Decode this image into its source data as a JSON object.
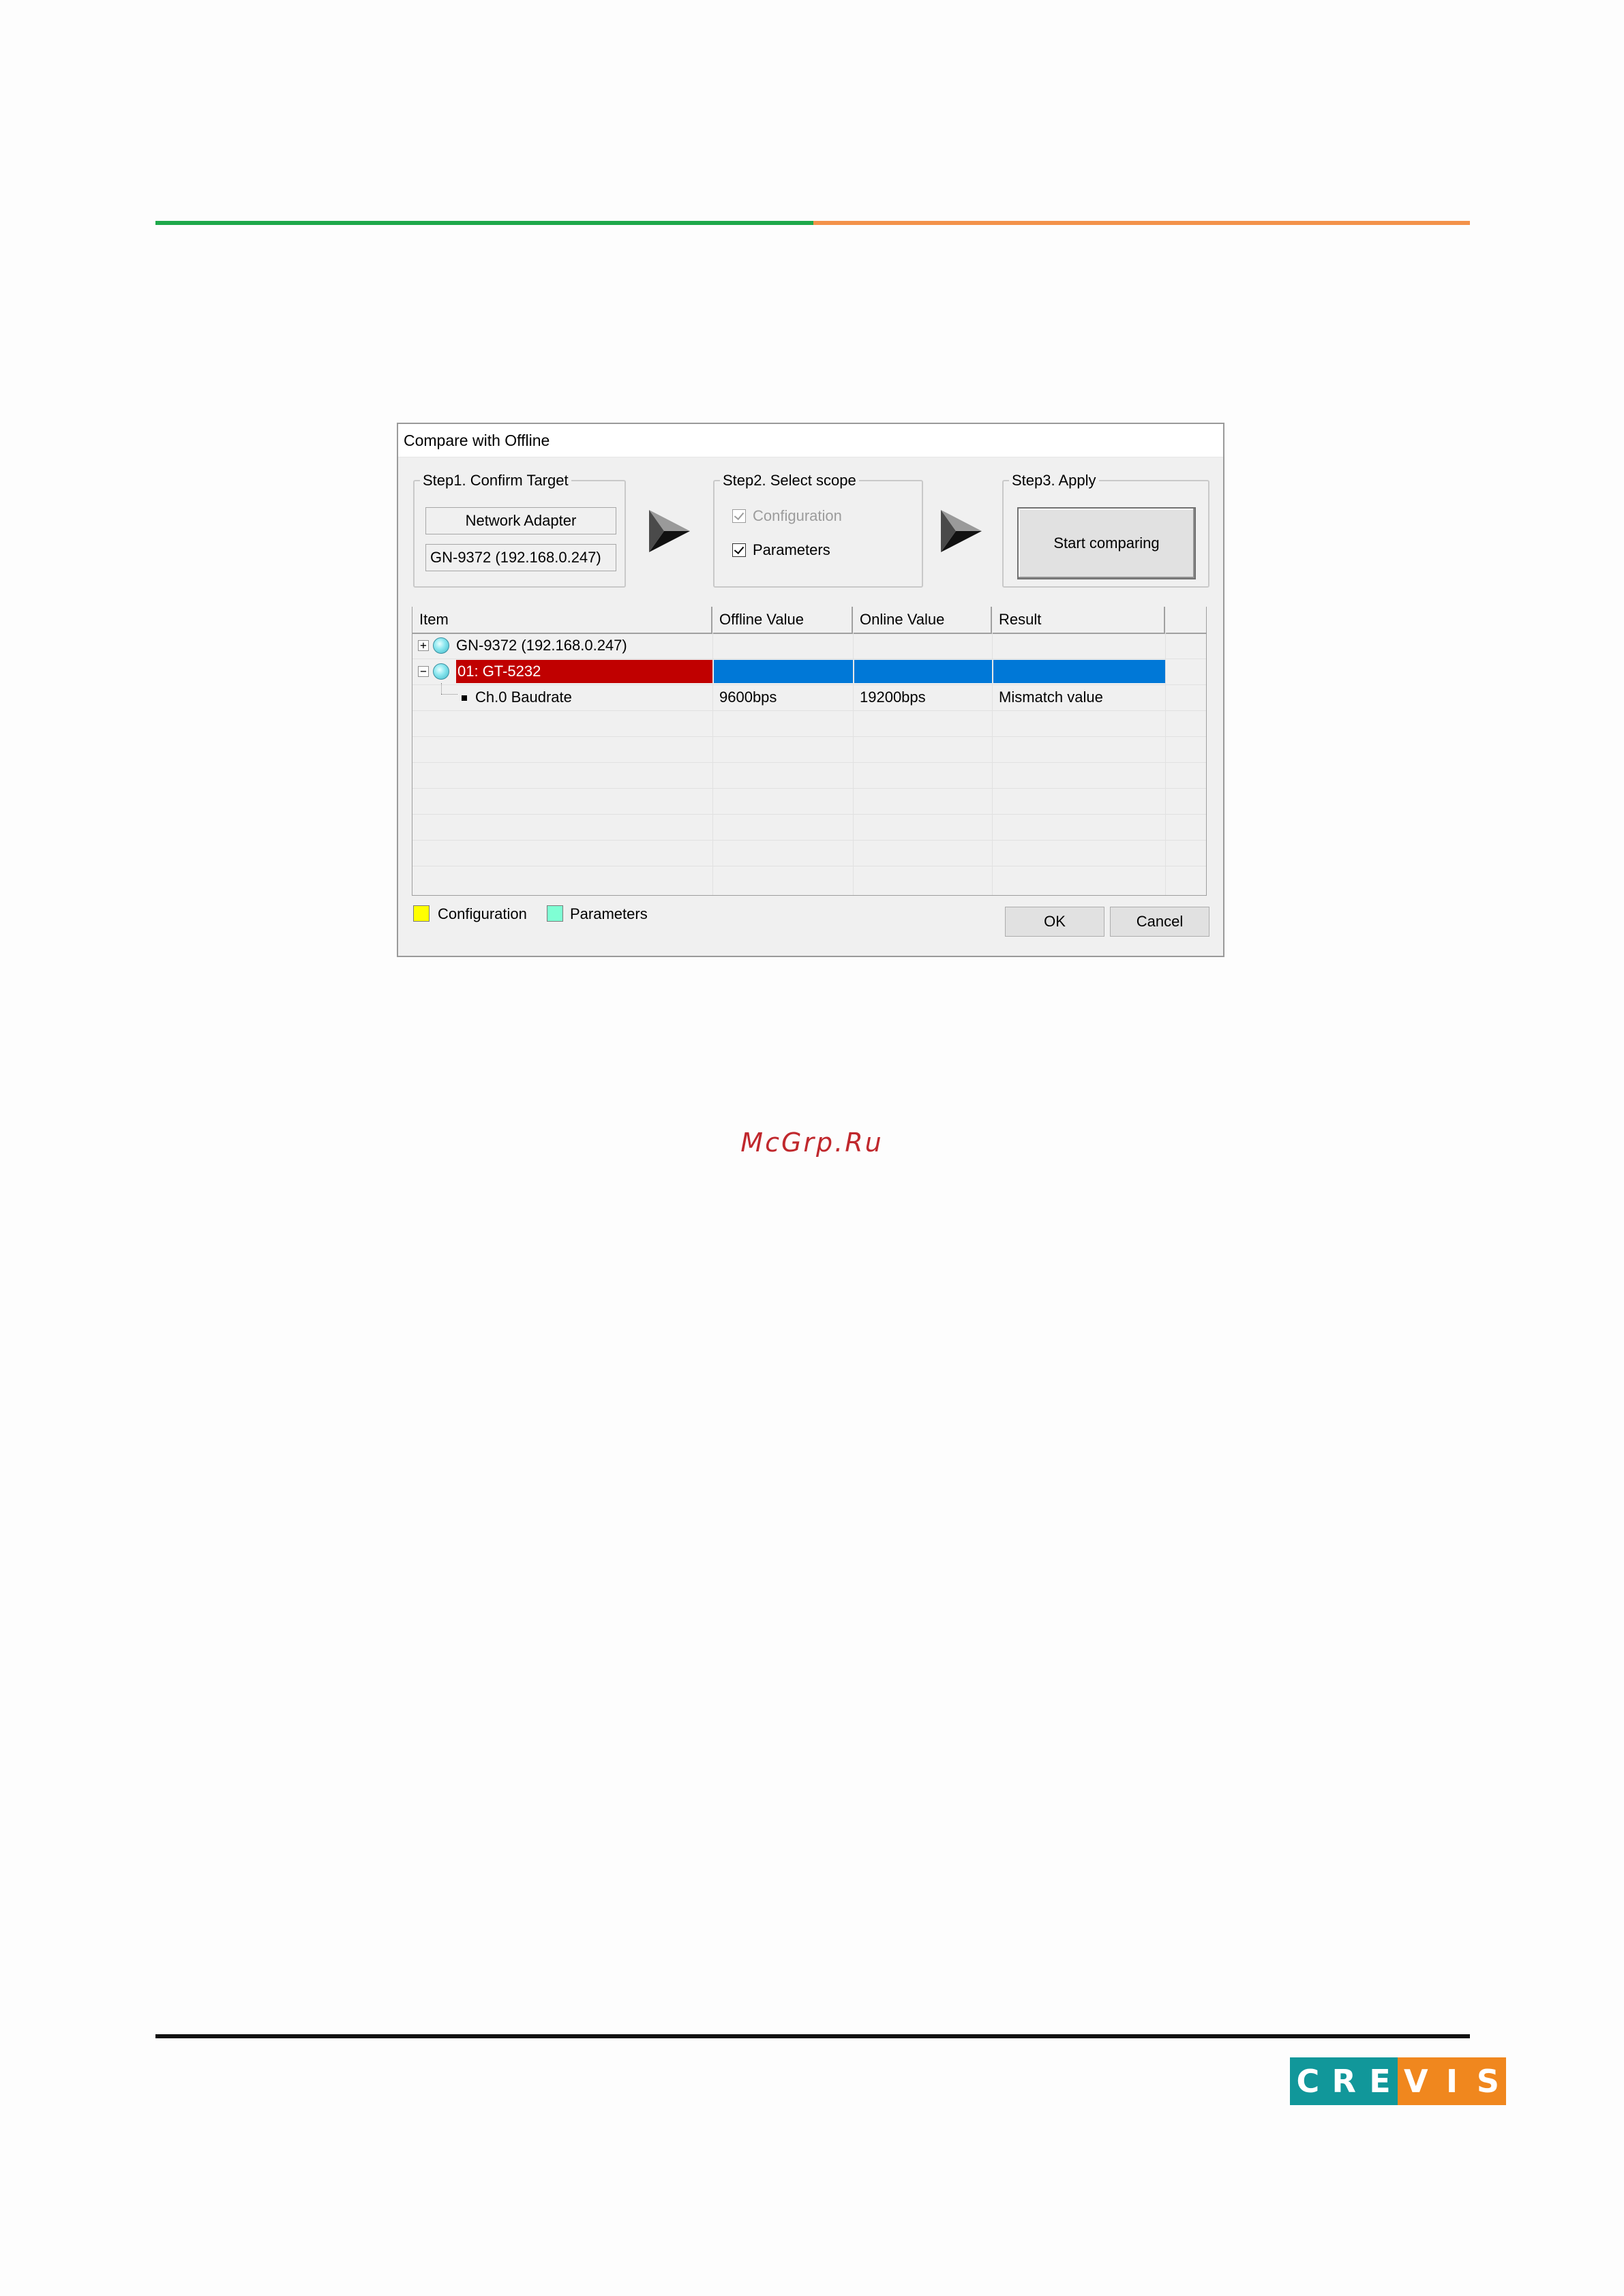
{
  "dialog": {
    "title": "Compare with Offline",
    "step1": {
      "legend": "Step1. Confirm Target",
      "type_value": "Network Adapter",
      "device_value": "GN-9372 (192.168.0.247)"
    },
    "step2": {
      "legend": "Step2. Select scope",
      "configuration_label": "Configuration",
      "parameters_label": "Parameters"
    },
    "step3": {
      "legend": "Step3. Apply",
      "start_label": "Start comparing"
    },
    "grid": {
      "columns": [
        "Item",
        "Offline Value",
        "Online Value",
        "Result"
      ],
      "rows": [
        {
          "item": "GN-9372 (192.168.0.247)",
          "offline": "",
          "online": "",
          "result": ""
        },
        {
          "item": "01: GT-5232",
          "offline": "",
          "online": "",
          "result": ""
        },
        {
          "item": "Ch.0 Baudrate",
          "offline": "9600bps",
          "online": "19200bps",
          "result": "Mismatch value"
        }
      ]
    },
    "legend": {
      "configuration_label": "Configuration",
      "parameters_label": "Parameters"
    },
    "ok_label": "OK",
    "cancel_label": "Cancel"
  },
  "watermark": "McGrp.Ru",
  "logo": {
    "letters": [
      "C",
      "R",
      "E",
      "V",
      "I",
      "S"
    ]
  },
  "colors": {
    "rule_green": "#1ea84b",
    "rule_orange": "#f3924a",
    "selected_red": "#c00000",
    "selected_blue": "#0078d7",
    "legend_configuration": "#ffff00",
    "legend_parameters": "#7fffd4",
    "logo_teal": "#11979a",
    "logo_orange": "#f0871e"
  }
}
